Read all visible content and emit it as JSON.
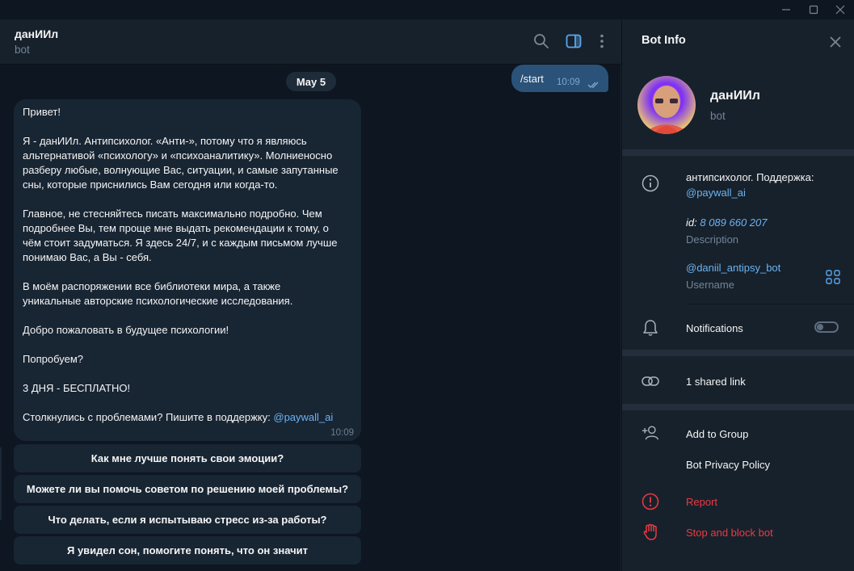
{
  "window": {
    "controls": [
      "minimize-icon",
      "maximize-icon",
      "close-icon"
    ]
  },
  "chat": {
    "title": "данИИл",
    "subtitle": "bot",
    "header_icons": [
      "search-icon",
      "sidebar-toggle-icon",
      "more-vertical-icon"
    ],
    "date_separator": "May 5",
    "outgoing": {
      "text": "/start",
      "time": "10:09",
      "status": "read"
    },
    "incoming": {
      "lines": [
        "Привет!",
        " Я - данИИл. Антипсихолог. «Анти-», потому что я являюсь",
        "альтернативой «психологу» и «психоаналитику». Молниеносно",
        "разберу любые, волнующие Вас, ситуации, и самые запутанные",
        "сны, которые приснились Вам сегодня или когда-то.",
        " Главное, не стесняйтесь писать максимально подробно. Чем",
        "подробнее Вы, тем проще мне выдать рекомендации к тому, о",
        "чём стоит задуматься. Я здесь 24/7, и с каждым письмом лучше",
        "понимаю Вас, а Вы - себя.",
        " В моём распоряжении все библиотеки мира, а также",
        "уникальные авторские психологические исследования.",
        " Добро пожаловать в будущее психологии!",
        " Попробуем?",
        " 3 ДНЯ - БЕСПЛАТНО!",
        " Столкнулись с проблемами? Пишите в поддержку: "
      ],
      "link": "@paywall_ai",
      "time": "10:09"
    },
    "keyboard": [
      "Как мне лучше понять свои эмоции?",
      "Можете ли вы помочь советом по решению моей проблемы?",
      "Что делать, если я испытываю стресс из-за работы?",
      "Я увидел сон, помогите понять, что он значит"
    ]
  },
  "panel": {
    "title": "Bot Info",
    "bot_name": "данИИл",
    "bot_sub": "bot",
    "description_line1": "антипсихолог. Поддержка:",
    "description_link": "@paywall_ai",
    "id_label": "id:",
    "id_value": "8 089 660 207",
    "description_caption": "Description",
    "username": "@daniil_antipsy_bot",
    "username_caption": "Username",
    "notifications": "Notifications",
    "notifications_on": false,
    "shared_links": "1 shared link",
    "add_to_group": "Add to Group",
    "privacy_policy": "Bot Privacy Policy",
    "report": "Report",
    "stop_block": "Stop and block bot"
  },
  "colors": {
    "chat_bg": "#0e1621",
    "panel_bg": "#17212b",
    "outgoing_bubble": "#2b5278",
    "incoming_bubble": "#182533",
    "link": "#6ab3f3",
    "danger": "#ec3942"
  }
}
